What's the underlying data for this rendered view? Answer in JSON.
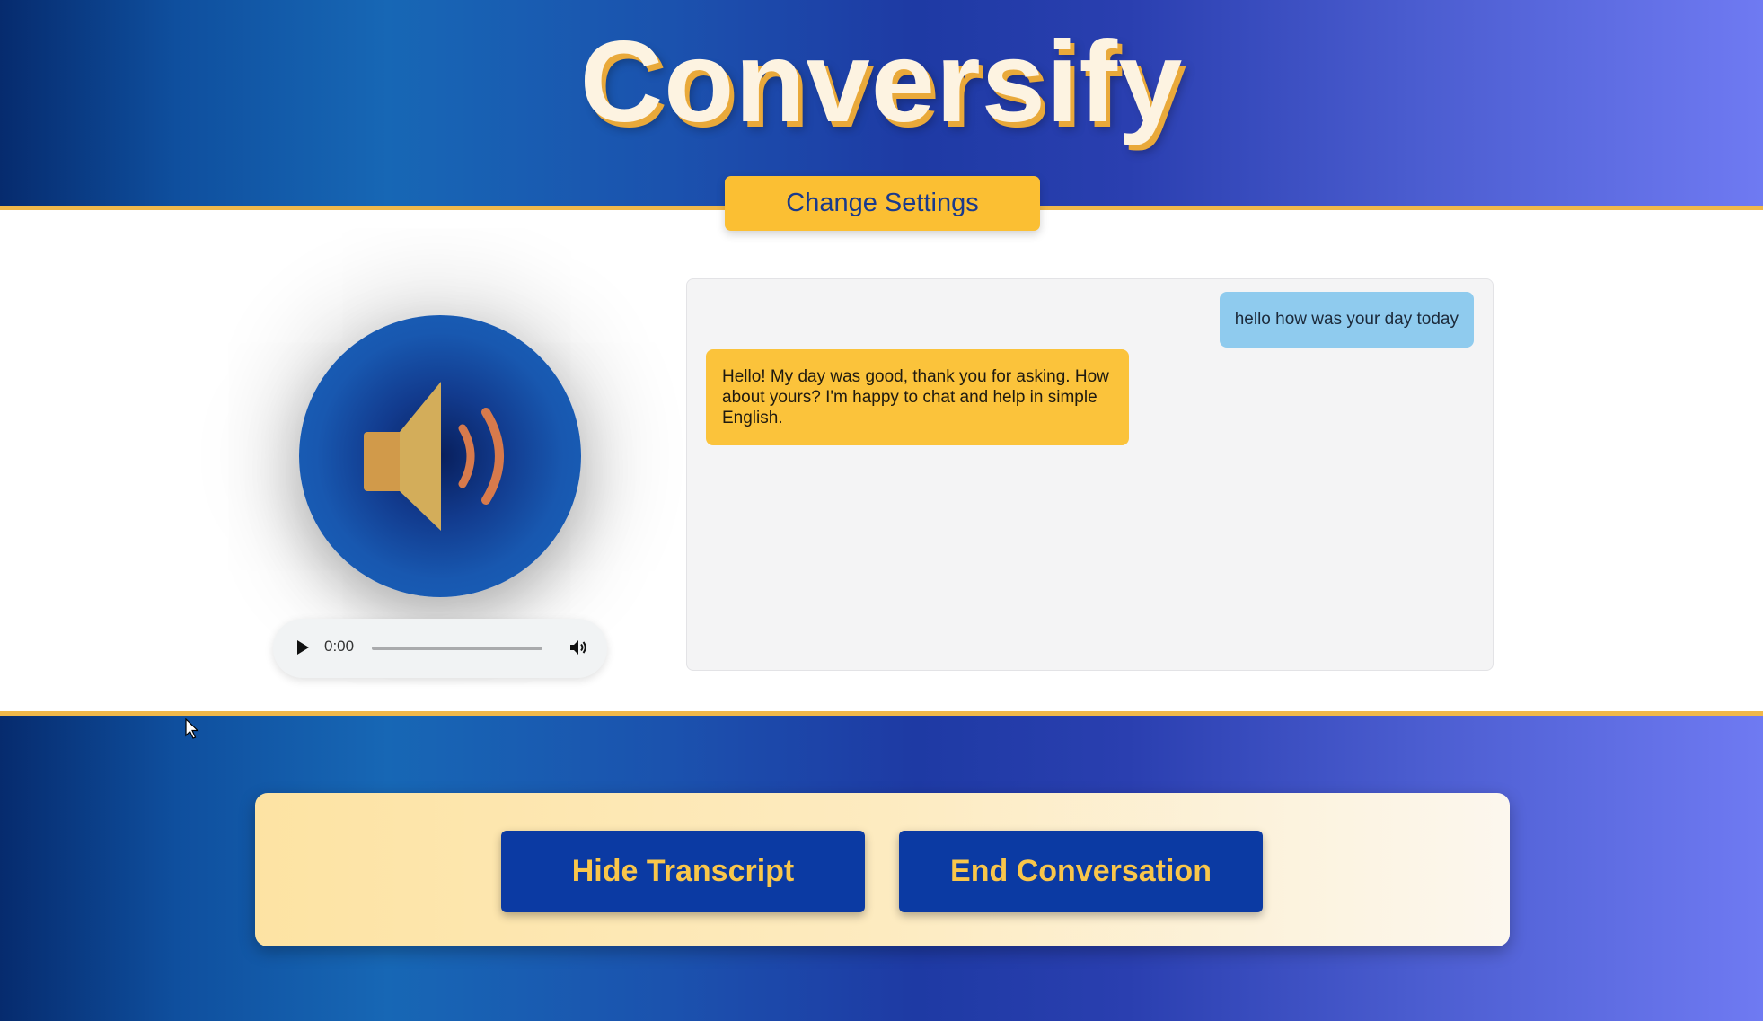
{
  "header": {
    "title": "Conversify",
    "settings_button": "Change Settings"
  },
  "player": {
    "time": "0:00",
    "progress": 0,
    "icons": [
      "play-icon",
      "volume-icon"
    ]
  },
  "speaker": {
    "icon": "speaker-volume-icon"
  },
  "transcript": {
    "messages": [
      {
        "role": "user",
        "text": "hello how was your day today"
      },
      {
        "role": "assistant",
        "text": "Hello! My day was good, thank you for asking. How about yours? I'm happy to chat and help in simple English."
      }
    ]
  },
  "controls": {
    "hide_transcript": "Hide Transcript",
    "end_conversation": "End Conversation"
  },
  "colors": {
    "accent_gold": "#fbbf33",
    "primary_blue": "#0b3aa3",
    "user_bubble": "#8fcbee",
    "assistant_bubble": "#fbc33b"
  }
}
